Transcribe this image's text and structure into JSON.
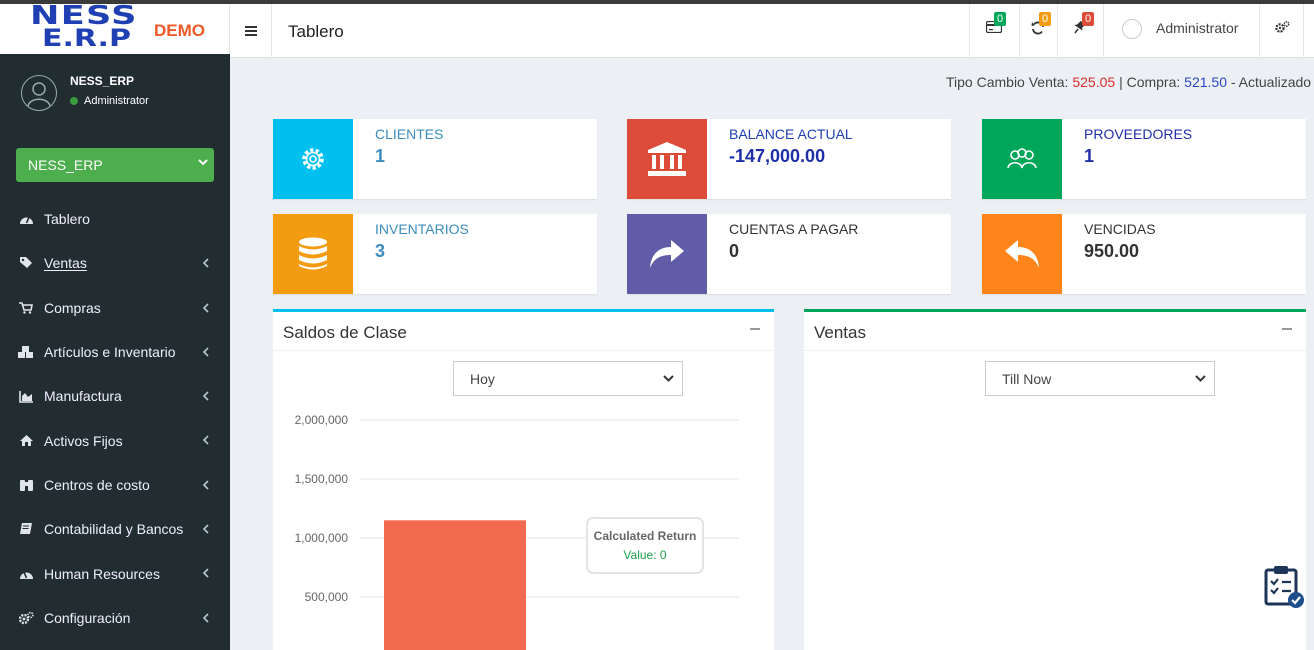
{
  "brand": {
    "name_line1": "NESS",
    "name_line2": "E.R.P",
    "tag": "DEMO"
  },
  "user": {
    "name": "NESS_ERP",
    "role": "Administrator"
  },
  "company_select": {
    "value": "NESS_ERP"
  },
  "nav": [
    {
      "label": "Tablero",
      "icon": "dashboard-icon",
      "has_arrow": false
    },
    {
      "label": "Ventas",
      "icon": "tags-icon",
      "has_arrow": true
    },
    {
      "label": "Compras",
      "icon": "cart-icon",
      "has_arrow": true
    },
    {
      "label": "Artículos e Inventario",
      "icon": "cubes-icon",
      "has_arrow": true
    },
    {
      "label": "Manufactura",
      "icon": "chart-area-icon",
      "has_arrow": true
    },
    {
      "label": "Activos Fijos",
      "icon": "home-icon",
      "has_arrow": true
    },
    {
      "label": "Centros de costo",
      "icon": "binoculars-icon",
      "has_arrow": true
    },
    {
      "label": "Contabilidad y Bancos",
      "icon": "book-icon",
      "has_arrow": true
    },
    {
      "label": "Human Resources",
      "icon": "gauge-icon",
      "has_arrow": true
    },
    {
      "label": "Configuración",
      "icon": "cogs-icon",
      "has_arrow": true
    }
  ],
  "header": {
    "title": "Tablero",
    "badges": {
      "payments": "0",
      "refresh": "0",
      "pin": "0"
    },
    "admin_label": "Administrator"
  },
  "exchange": {
    "prefix": "Tipo Cambio Venta:",
    "sell": "525.05",
    "mid": "| Compra:",
    "buy": "521.50",
    "suffix": "- Actualizado"
  },
  "boxes": [
    {
      "label": "CLIENTES",
      "value": "1",
      "color": "#00c0ef",
      "icon": "gear-icon"
    },
    {
      "label": "BALANCE ACTUAL",
      "value": "-147,000.00",
      "color": "#dd4b39",
      "icon": "bank-icon"
    },
    {
      "label": "PROVEEDORES",
      "value": "1",
      "color": "#00a65a",
      "icon": "users-icon"
    },
    {
      "label": "INVENTARIOS",
      "value": "3",
      "color": "#f39c12",
      "icon": "database-icon"
    },
    {
      "label": "CUENTAS A PAGAR",
      "value": "0",
      "color": "#605ca8",
      "icon": "share-icon"
    },
    {
      "label": "VENCIDAS",
      "value": "950.00",
      "color": "#ff851b",
      "icon": "reply-icon"
    }
  ],
  "panels": {
    "saldos": {
      "title": "Saldos de Clase",
      "select": "Hoy",
      "accent": "#00c0ef"
    },
    "ventas": {
      "title": "Ventas",
      "select": "Till Now",
      "accent": "#00a65a"
    }
  },
  "chart_data": {
    "type": "bar",
    "title": "",
    "xlabel": "",
    "ylabel": "",
    "ylim": [
      0,
      2000000
    ],
    "y_ticks": [
      "2,000,000",
      "1,500,000",
      "1,000,000",
      "500,000"
    ],
    "y_tick_values": [
      2000000,
      1500000,
      1000000,
      500000
    ],
    "series": [
      {
        "name": "Calculated Return",
        "values": [
          1150000
        ],
        "color": "#f26b50"
      }
    ],
    "tooltip": {
      "title": "Calculated Return",
      "value_text": "Value: 0"
    }
  }
}
